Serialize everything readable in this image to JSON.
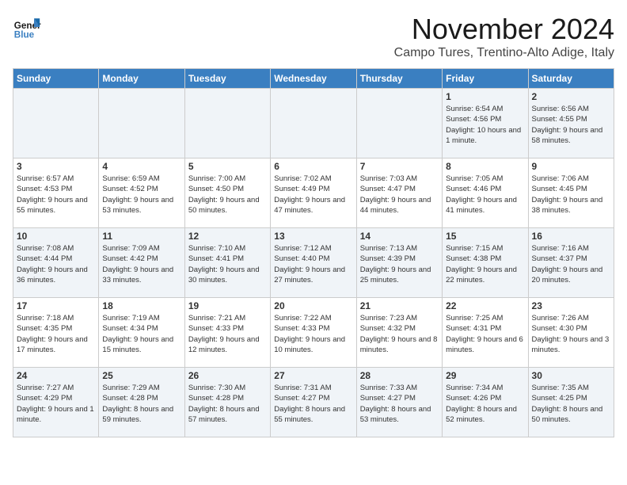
{
  "header": {
    "logo_line1": "General",
    "logo_line2": "Blue",
    "month": "November 2024",
    "location": "Campo Tures, Trentino-Alto Adige, Italy"
  },
  "weekdays": [
    "Sunday",
    "Monday",
    "Tuesday",
    "Wednesday",
    "Thursday",
    "Friday",
    "Saturday"
  ],
  "weeks": [
    [
      {
        "day": "",
        "info": ""
      },
      {
        "day": "",
        "info": ""
      },
      {
        "day": "",
        "info": ""
      },
      {
        "day": "",
        "info": ""
      },
      {
        "day": "",
        "info": ""
      },
      {
        "day": "1",
        "info": "Sunrise: 6:54 AM\nSunset: 4:56 PM\nDaylight: 10 hours and 1 minute."
      },
      {
        "day": "2",
        "info": "Sunrise: 6:56 AM\nSunset: 4:55 PM\nDaylight: 9 hours and 58 minutes."
      }
    ],
    [
      {
        "day": "3",
        "info": "Sunrise: 6:57 AM\nSunset: 4:53 PM\nDaylight: 9 hours and 55 minutes."
      },
      {
        "day": "4",
        "info": "Sunrise: 6:59 AM\nSunset: 4:52 PM\nDaylight: 9 hours and 53 minutes."
      },
      {
        "day": "5",
        "info": "Sunrise: 7:00 AM\nSunset: 4:50 PM\nDaylight: 9 hours and 50 minutes."
      },
      {
        "day": "6",
        "info": "Sunrise: 7:02 AM\nSunset: 4:49 PM\nDaylight: 9 hours and 47 minutes."
      },
      {
        "day": "7",
        "info": "Sunrise: 7:03 AM\nSunset: 4:47 PM\nDaylight: 9 hours and 44 minutes."
      },
      {
        "day": "8",
        "info": "Sunrise: 7:05 AM\nSunset: 4:46 PM\nDaylight: 9 hours and 41 minutes."
      },
      {
        "day": "9",
        "info": "Sunrise: 7:06 AM\nSunset: 4:45 PM\nDaylight: 9 hours and 38 minutes."
      }
    ],
    [
      {
        "day": "10",
        "info": "Sunrise: 7:08 AM\nSunset: 4:44 PM\nDaylight: 9 hours and 36 minutes."
      },
      {
        "day": "11",
        "info": "Sunrise: 7:09 AM\nSunset: 4:42 PM\nDaylight: 9 hours and 33 minutes."
      },
      {
        "day": "12",
        "info": "Sunrise: 7:10 AM\nSunset: 4:41 PM\nDaylight: 9 hours and 30 minutes."
      },
      {
        "day": "13",
        "info": "Sunrise: 7:12 AM\nSunset: 4:40 PM\nDaylight: 9 hours and 27 minutes."
      },
      {
        "day": "14",
        "info": "Sunrise: 7:13 AM\nSunset: 4:39 PM\nDaylight: 9 hours and 25 minutes."
      },
      {
        "day": "15",
        "info": "Sunrise: 7:15 AM\nSunset: 4:38 PM\nDaylight: 9 hours and 22 minutes."
      },
      {
        "day": "16",
        "info": "Sunrise: 7:16 AM\nSunset: 4:37 PM\nDaylight: 9 hours and 20 minutes."
      }
    ],
    [
      {
        "day": "17",
        "info": "Sunrise: 7:18 AM\nSunset: 4:35 PM\nDaylight: 9 hours and 17 minutes."
      },
      {
        "day": "18",
        "info": "Sunrise: 7:19 AM\nSunset: 4:34 PM\nDaylight: 9 hours and 15 minutes."
      },
      {
        "day": "19",
        "info": "Sunrise: 7:21 AM\nSunset: 4:33 PM\nDaylight: 9 hours and 12 minutes."
      },
      {
        "day": "20",
        "info": "Sunrise: 7:22 AM\nSunset: 4:33 PM\nDaylight: 9 hours and 10 minutes."
      },
      {
        "day": "21",
        "info": "Sunrise: 7:23 AM\nSunset: 4:32 PM\nDaylight: 9 hours and 8 minutes."
      },
      {
        "day": "22",
        "info": "Sunrise: 7:25 AM\nSunset: 4:31 PM\nDaylight: 9 hours and 6 minutes."
      },
      {
        "day": "23",
        "info": "Sunrise: 7:26 AM\nSunset: 4:30 PM\nDaylight: 9 hours and 3 minutes."
      }
    ],
    [
      {
        "day": "24",
        "info": "Sunrise: 7:27 AM\nSunset: 4:29 PM\nDaylight: 9 hours and 1 minute."
      },
      {
        "day": "25",
        "info": "Sunrise: 7:29 AM\nSunset: 4:28 PM\nDaylight: 8 hours and 59 minutes."
      },
      {
        "day": "26",
        "info": "Sunrise: 7:30 AM\nSunset: 4:28 PM\nDaylight: 8 hours and 57 minutes."
      },
      {
        "day": "27",
        "info": "Sunrise: 7:31 AM\nSunset: 4:27 PM\nDaylight: 8 hours and 55 minutes."
      },
      {
        "day": "28",
        "info": "Sunrise: 7:33 AM\nSunset: 4:27 PM\nDaylight: 8 hours and 53 minutes."
      },
      {
        "day": "29",
        "info": "Sunrise: 7:34 AM\nSunset: 4:26 PM\nDaylight: 8 hours and 52 minutes."
      },
      {
        "day": "30",
        "info": "Sunrise: 7:35 AM\nSunset: 4:25 PM\nDaylight: 8 hours and 50 minutes."
      }
    ]
  ]
}
